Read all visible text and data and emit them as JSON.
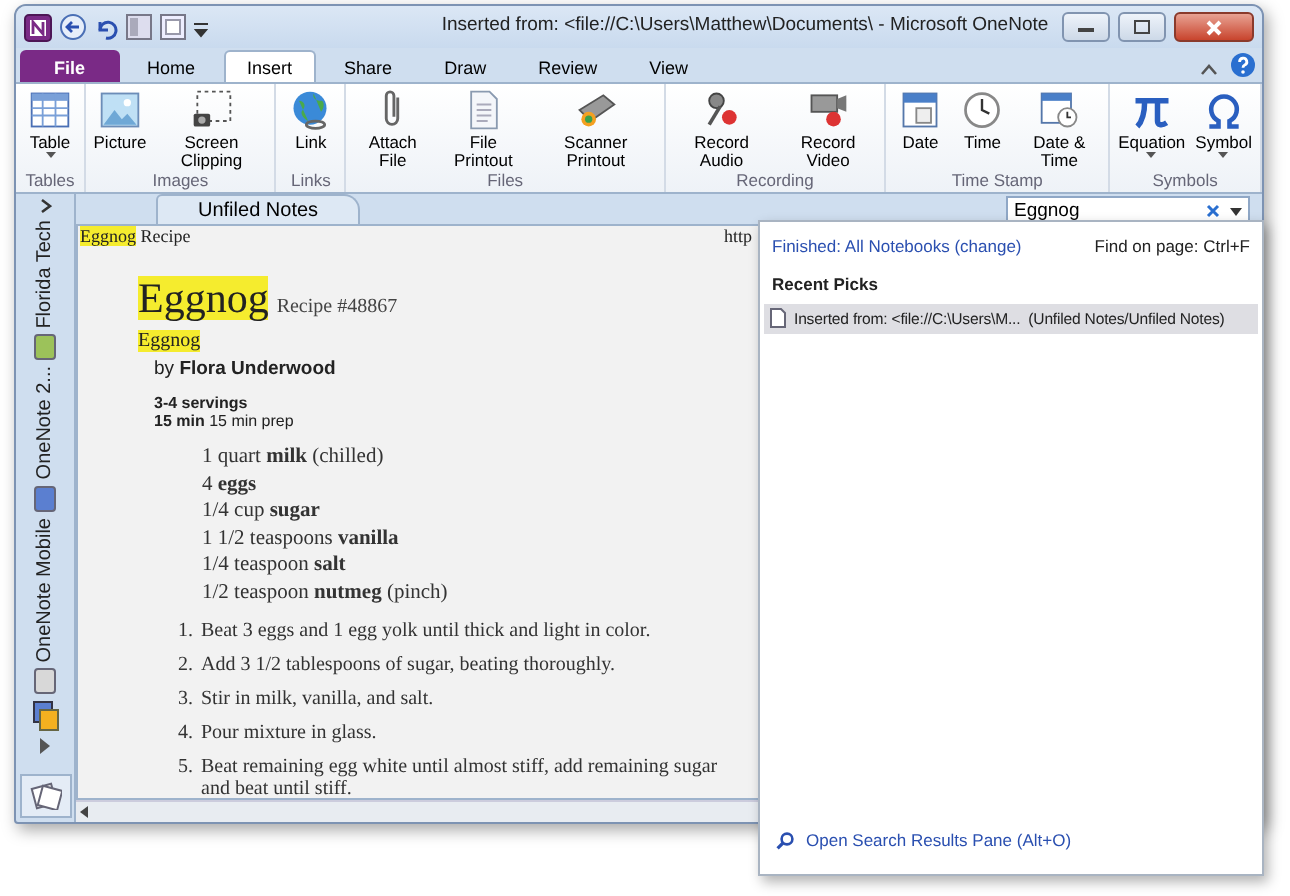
{
  "window": {
    "title": "Inserted from: <file://C:\\Users\\Matthew\\Documents\\ - Microsoft OneNote"
  },
  "tabs": [
    {
      "label": "File",
      "kind": "file",
      "selected": false
    },
    {
      "label": "Home",
      "kind": "tab",
      "selected": false
    },
    {
      "label": "Insert",
      "kind": "tab",
      "selected": true
    },
    {
      "label": "Share",
      "kind": "tab",
      "selected": false
    },
    {
      "label": "Draw",
      "kind": "tab",
      "selected": false
    },
    {
      "label": "Review",
      "kind": "tab",
      "selected": false
    },
    {
      "label": "View",
      "kind": "tab",
      "selected": false
    }
  ],
  "ribbon": [
    {
      "label": "Tables",
      "buttons": [
        {
          "label": "Table",
          "dropdown": true
        }
      ]
    },
    {
      "label": "Images",
      "buttons": [
        {
          "label": "Picture",
          "dropdown": false
        },
        {
          "label": "Screen Clipping",
          "dropdown": false
        }
      ]
    },
    {
      "label": "Links",
      "buttons": [
        {
          "label": "Link",
          "dropdown": false
        }
      ]
    },
    {
      "label": "Files",
      "buttons": [
        {
          "label": "Attach File",
          "dropdown": false
        },
        {
          "label": "File Printout",
          "dropdown": false
        },
        {
          "label": "Scanner Printout",
          "dropdown": false
        }
      ]
    },
    {
      "label": "Recording",
      "buttons": [
        {
          "label": "Record Audio",
          "dropdown": false
        },
        {
          "label": "Record Video",
          "dropdown": false
        }
      ]
    },
    {
      "label": "Time Stamp",
      "buttons": [
        {
          "label": "Date",
          "dropdown": false
        },
        {
          "label": "Time",
          "dropdown": false
        },
        {
          "label": "Date & Time",
          "dropdown": false
        }
      ]
    },
    {
      "label": "Symbols",
      "buttons": [
        {
          "label": "Equation",
          "dropdown": true
        },
        {
          "label": "Symbol",
          "dropdown": true
        }
      ]
    }
  ],
  "notebooks": [
    {
      "label": "Florida Tech",
      "color": "#9cc25a"
    },
    {
      "label": "OneNote 2...",
      "color": "#5b7fd0"
    },
    {
      "label": "OneNote Mobile",
      "color": "#d8d8d8"
    }
  ],
  "section_tab": {
    "label": "Unfiled Notes"
  },
  "search": {
    "value": "Eggnog"
  },
  "page": {
    "header": [
      {
        "text": "Eggnog",
        "highlighted": true
      },
      {
        "text": "Recipe",
        "highlighted": false
      }
    ],
    "header_right": "http",
    "title": {
      "text": "Eggnog",
      "highlighted": true
    },
    "recipe_number": "Recipe #48867",
    "subtitle": {
      "text": "Eggnog",
      "highlighted": true
    },
    "byline": "by **Flora Underwood**",
    "servings": "3-4 servings",
    "time": "**15 min** 15 min prep",
    "ingredients": [
      "1 quart **milk** (chilled)",
      "4 **eggs**",
      "1/4 cup **sugar**",
      "1 1/2 teaspoons **vanilla**",
      "1/4 teaspoon **salt**",
      "1/2 teaspoon **nutmeg** (pinch)"
    ],
    "steps": [
      {
        "number": "1.",
        "text": "Beat 3 eggs and 1 egg yolk until thick and light in color."
      },
      {
        "number": "2.",
        "text": "Add 3 1/2 tablespoons of sugar, beating thoroughly."
      },
      {
        "number": "3.",
        "text": "Stir in milk, vanilla, and salt."
      },
      {
        "number": "4.",
        "text": "Pour mixture in glass."
      },
      {
        "number": "5.",
        "text": "Beat remaining egg white until almost stiff, add remaining sugar and beat until stiff."
      }
    ]
  },
  "search_results": {
    "status": "Finished:",
    "scope": "All Notebooks (change)",
    "find_on_page": "Find on page: Ctrl+F",
    "heading": "Recent Picks",
    "results": [
      {
        "title": "Inserted from: <file://C:\\Users\\M...",
        "location": "(Unfiled Notes/Unfiled Notes)",
        "selected": true
      }
    ],
    "footer": "Open Search Results Pane (Alt+O)"
  }
}
